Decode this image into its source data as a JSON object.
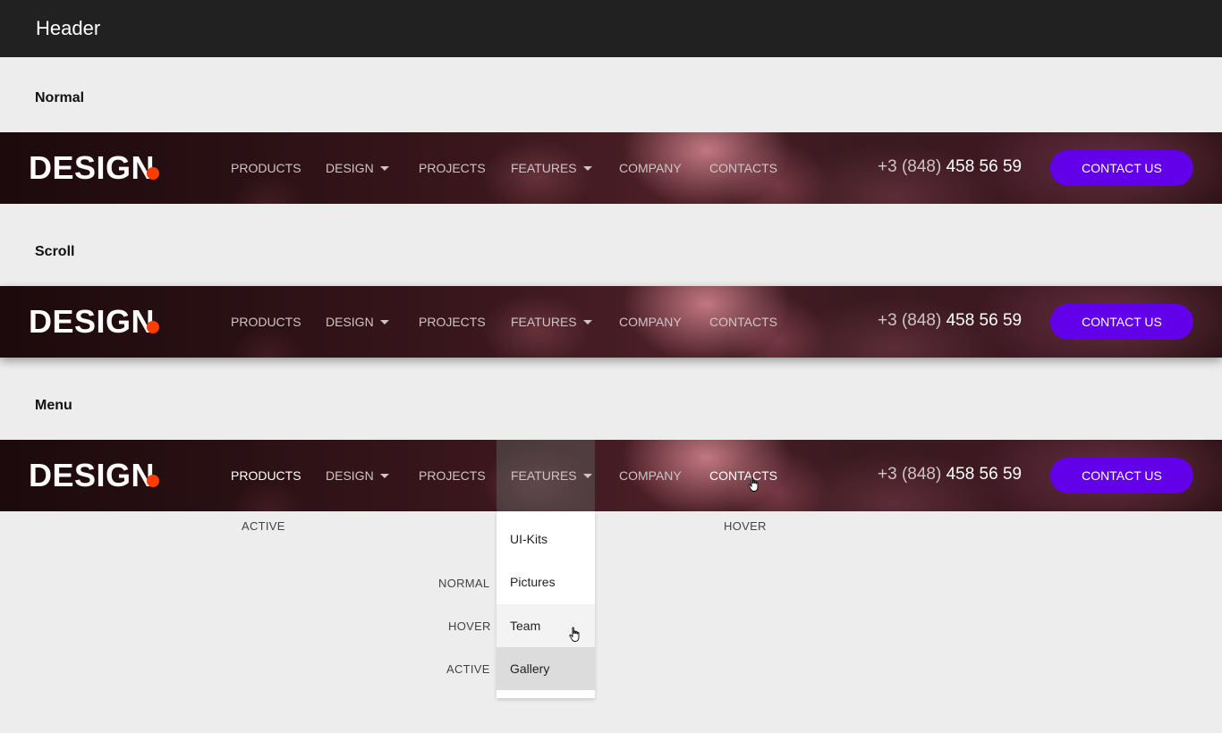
{
  "header": {
    "title": "Header"
  },
  "sections": {
    "normal": "Normal",
    "scroll": "Scroll",
    "menu": "Menu"
  },
  "navbar": {
    "logo": "DESIGN",
    "items": [
      {
        "label": "PRODUCTS"
      },
      {
        "label": "DESIGN"
      },
      {
        "label": "PROJECTS"
      },
      {
        "label": "FEATURES"
      },
      {
        "label": "COMPANY"
      },
      {
        "label": "CONTACTS"
      }
    ],
    "phone_code": "+3 (848)",
    "phone_number": "458 56 59",
    "cta": "CONTACT US"
  },
  "states": {
    "active": "ACTIVE",
    "hover": "HOVER",
    "normal": "NORMAL"
  },
  "dropdown": {
    "items": [
      {
        "label": "UI-Kits"
      },
      {
        "label": "Pictures"
      },
      {
        "label": "Team"
      },
      {
        "label": "Gallery"
      }
    ]
  },
  "colors": {
    "accent": "#6200ea",
    "logo_dot": "#ff3d00",
    "topbar": "#212121",
    "page_bg": "#ededed"
  },
  "icons": {
    "caret": "caret-down-icon",
    "cursor": "hand-cursor-icon"
  }
}
